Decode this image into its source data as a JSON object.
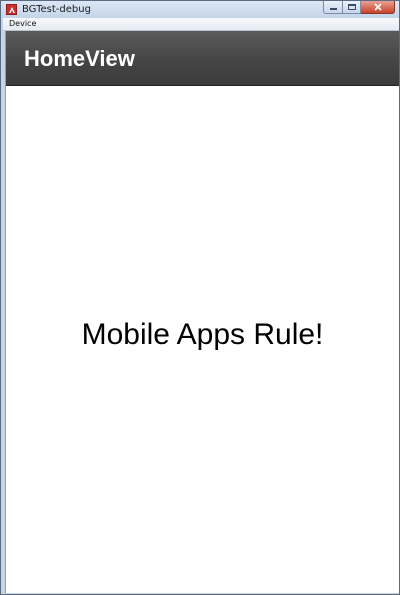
{
  "window": {
    "title": "BGTest-debug",
    "icon": "air-app-icon"
  },
  "menubar": {
    "items": [
      {
        "label": "Device"
      }
    ]
  },
  "actionbar": {
    "title": "HomeView"
  },
  "view": {
    "label": "Mobile Apps Rule!"
  },
  "colors": {
    "actionbar_bg": "#454545",
    "actionbar_text": "#ffffff",
    "body_bg": "#ffffff",
    "label_text": "#000000",
    "app_icon_red": "#c9302c"
  }
}
